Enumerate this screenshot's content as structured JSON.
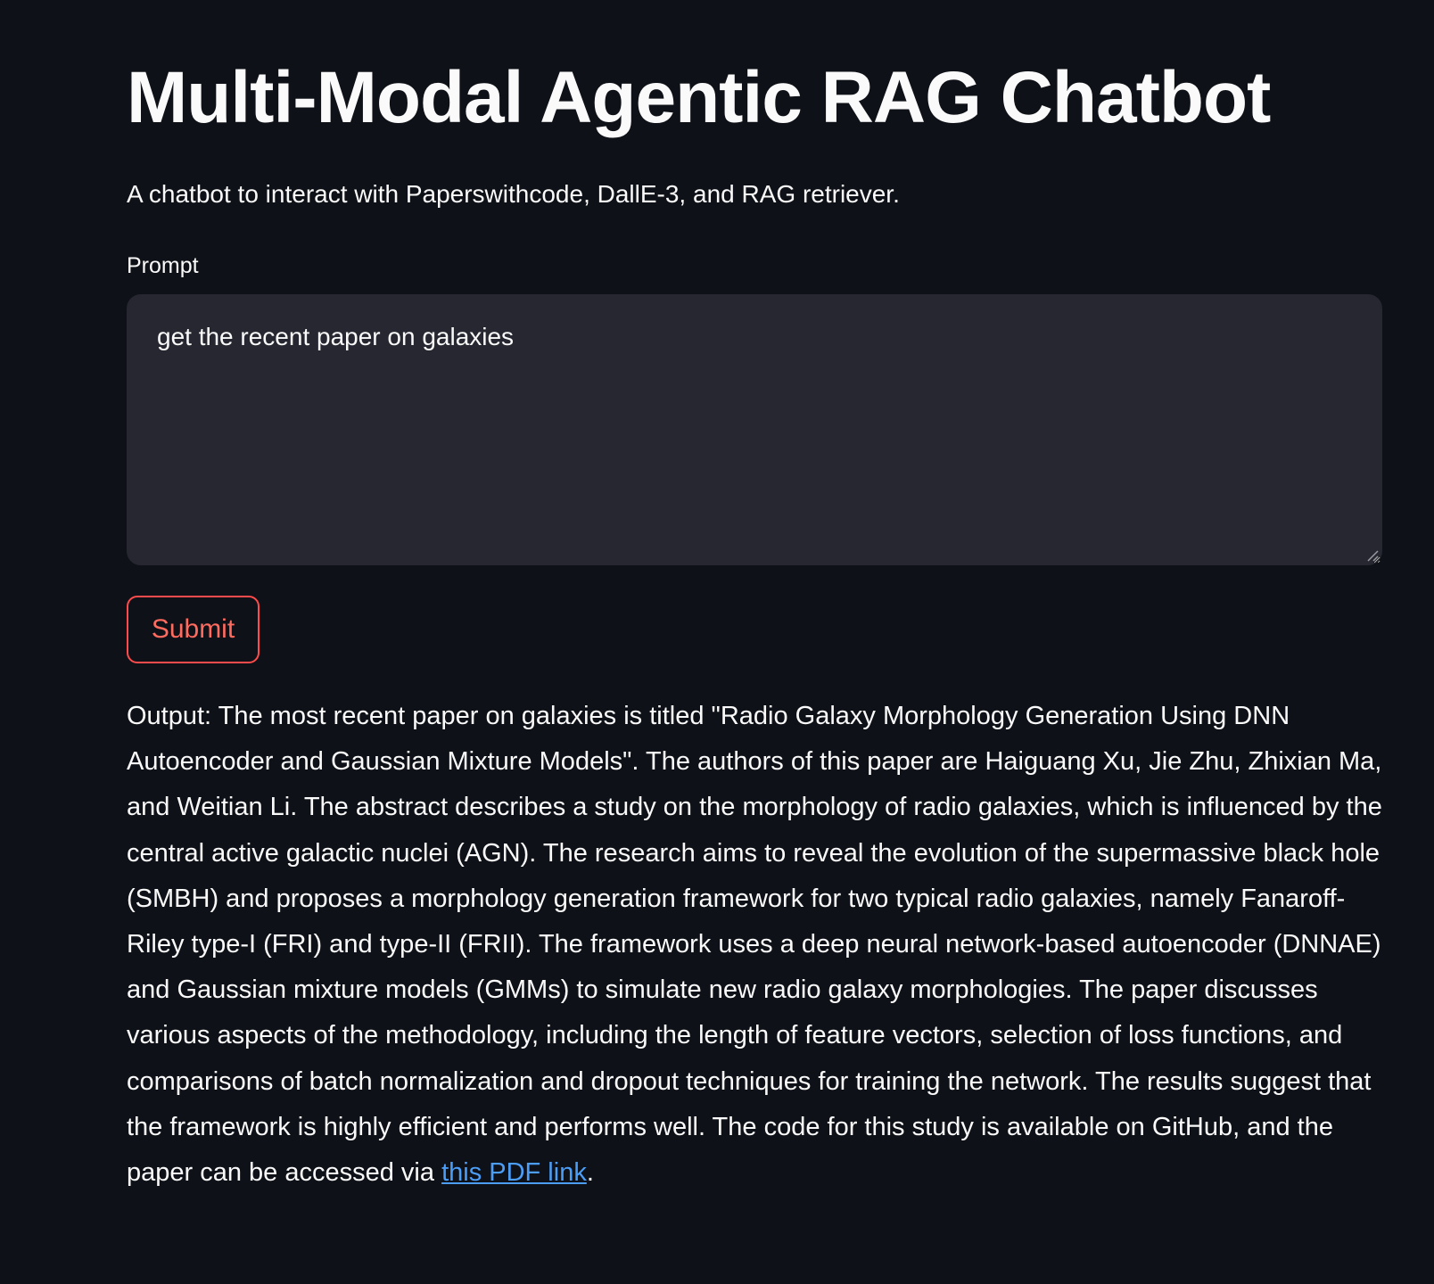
{
  "app": {
    "title": "Multi-Modal Agentic RAG Chatbot",
    "subtitle": "A chatbot to interact with Paperswithcode, DallE-3, and RAG retriever."
  },
  "prompt": {
    "label": "Prompt",
    "value": "get the recent paper on galaxies"
  },
  "submit": {
    "label": "Submit"
  },
  "output": {
    "text": "Output: The most recent paper on galaxies is titled \"Radio Galaxy Morphology Generation Using DNN Autoencoder and Gaussian Mixture Models\". The authors of this paper are Haiguang Xu, Jie Zhu, Zhixian Ma, and Weitian Li. The abstract describes a study on the morphology of radio galaxies, which is influenced by the central active galactic nuclei (AGN). The research aims to reveal the evolution of the supermassive black hole (SMBH) and proposes a morphology generation framework for two typical radio galaxies, namely Fanaroff-Riley type-I (FRI) and type-II (FRII). The framework uses a deep neural network-based autoencoder (DNNAE) and Gaussian mixture models (GMMs) to simulate new radio galaxy morphologies. The paper discusses various aspects of the methodology, including the length of feature vectors, selection of loss functions, and comparisons of batch normalization and dropout techniques for training the network. The results suggest that the framework is highly efficient and performs well. The code for this study is available on GitHub, and the paper can be accessed via ",
    "link_text": "this PDF link",
    "trailing": "."
  },
  "colors": {
    "background": "#0e1117",
    "input_background": "#262730",
    "accent": "#ff4b4b",
    "link": "#4c9df5"
  }
}
